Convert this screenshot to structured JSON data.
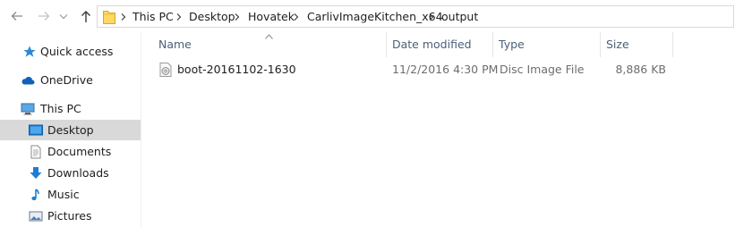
{
  "breadcrumb": {
    "items": [
      "This PC",
      "Desktop",
      "Hovatek",
      "CarlivImageKitchen_x64",
      "output"
    ]
  },
  "nav": {
    "items": [
      {
        "label": "Quick access",
        "icon": "star-icon"
      },
      {
        "label": "OneDrive",
        "icon": "cloud-icon"
      },
      {
        "label": "This PC",
        "icon": "computer-icon"
      },
      {
        "label": "Desktop",
        "icon": "desktop-icon"
      },
      {
        "label": "Documents",
        "icon": "documents-icon"
      },
      {
        "label": "Downloads",
        "icon": "download-icon"
      },
      {
        "label": "Music",
        "icon": "music-icon"
      },
      {
        "label": "Pictures",
        "icon": "pictures-icon"
      }
    ]
  },
  "columns": {
    "name": "Name",
    "date_modified": "Date modified",
    "type": "Type",
    "size": "Size"
  },
  "files": [
    {
      "name": "boot-20161102-1630",
      "date_modified": "11/2/2016 4:30 PM",
      "type": "Disc Image File",
      "size": "8,886 KB"
    }
  ],
  "colors": {
    "accent": "#0078d7",
    "folder": "#ffd865",
    "hover": "#d9d9d9",
    "header_text": "#4c607a"
  }
}
